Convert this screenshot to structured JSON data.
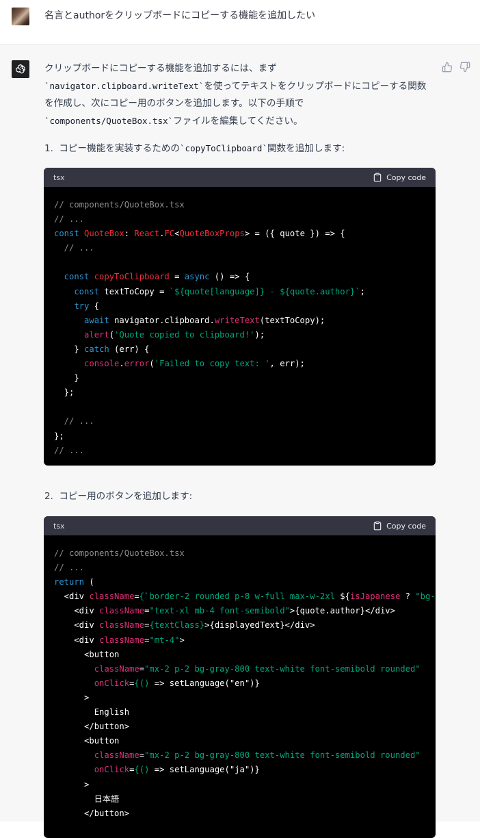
{
  "user": {
    "message": "名言とauthorをクリップボードにコピーする機能を追加したい"
  },
  "assistant": {
    "intro_1": "クリップボードにコピーする機能を追加するには、まず",
    "intro_2_code": "`navigator.clipboard.writeText`",
    "intro_2_text": "を使ってテキストをクリップボードにコピーする関数",
    "intro_3": "を作成し、次にコピー用のボタンを追加します。以下の手順で",
    "intro_4_code": "`components/QuoteBox.tsx`",
    "intro_4_text": "ファイルを編集してください。",
    "step1_number": "1.",
    "step1_text_a": "コピー機能を実装するための",
    "step1_code": "`copyToClipboard`",
    "step1_text_b": "関数を追加します:",
    "step2_number": "2.",
    "step2_text": "コピー用のボタンを追加します:"
  },
  "code_blocks": [
    {
      "language": "tsx",
      "copy_label": "Copy code",
      "lines": [
        [
          [
            "c-cm",
            "// components/QuoteBox.tsx"
          ]
        ],
        [
          [
            "c-cm",
            "// ..."
          ]
        ],
        [
          [
            "c-kw",
            "const "
          ],
          [
            "c-ty",
            "QuoteBox"
          ],
          [
            "c-tx",
            ": "
          ],
          [
            "c-ty",
            "React"
          ],
          [
            "c-tx",
            "."
          ],
          [
            "c-ty",
            "FC"
          ],
          [
            "c-tx",
            "<"
          ],
          [
            "c-ty",
            "QuoteBoxProps"
          ],
          [
            "c-tx",
            "> = ({ quote }) => {"
          ]
        ],
        [
          [
            "c-cm",
            "  // ..."
          ]
        ],
        [
          [
            "c-tx",
            ""
          ]
        ],
        [
          [
            "c-kw",
            "  const "
          ],
          [
            "c-ty",
            "copyToClipboard"
          ],
          [
            "c-tx",
            " = "
          ],
          [
            "c-kw",
            "async"
          ],
          [
            "c-tx",
            " () => {"
          ]
        ],
        [
          [
            "c-kw",
            "    const "
          ],
          [
            "c-tx",
            "textToCopy = "
          ],
          [
            "c-st",
            "`${quote[language]} - ${quote.author}`"
          ],
          [
            "c-tx",
            ";"
          ]
        ],
        [
          [
            "c-kw",
            "    try"
          ],
          [
            "c-tx",
            " {"
          ]
        ],
        [
          [
            "c-kw",
            "      await "
          ],
          [
            "c-tx",
            "navigator.clipboard."
          ],
          [
            "c-fn",
            "writeText"
          ],
          [
            "c-tx",
            "(textToCopy);"
          ]
        ],
        [
          [
            "c-fn",
            "      alert"
          ],
          [
            "c-tx",
            "("
          ],
          [
            "c-st",
            "'Quote copied to clipboard!'"
          ],
          [
            "c-tx",
            ");"
          ]
        ],
        [
          [
            "c-tx",
            "    } "
          ],
          [
            "c-kw",
            "catch"
          ],
          [
            "c-tx",
            " (err) {"
          ]
        ],
        [
          [
            "c-fn",
            "      console"
          ],
          [
            "c-tx",
            "."
          ],
          [
            "c-fn",
            "error"
          ],
          [
            "c-tx",
            "("
          ],
          [
            "c-st",
            "'Failed to copy text: '"
          ],
          [
            "c-tx",
            ", err);"
          ]
        ],
        [
          [
            "c-tx",
            "    }"
          ]
        ],
        [
          [
            "c-tx",
            "  };"
          ]
        ],
        [
          [
            "c-tx",
            ""
          ]
        ],
        [
          [
            "c-cm",
            "  // ..."
          ]
        ],
        [
          [
            "c-tx",
            "};"
          ]
        ],
        [
          [
            "c-cm",
            "// ..."
          ]
        ]
      ]
    },
    {
      "language": "tsx",
      "copy_label": "Copy code",
      "lines": [
        [
          [
            "c-cm",
            "// components/QuoteBox.tsx"
          ]
        ],
        [
          [
            "c-cm",
            "// ..."
          ]
        ],
        [
          [
            "c-kw",
            "return"
          ],
          [
            "c-tx",
            " ("
          ]
        ],
        [
          [
            "c-tx",
            "  <div "
          ],
          [
            "c-fn",
            "className"
          ],
          [
            "c-tx",
            "="
          ],
          [
            "c-st",
            "{`border-2 rounded p-8 w-full max-w-2xl "
          ],
          [
            "c-tx",
            "${"
          ],
          [
            "c-fn",
            "isJapanese"
          ],
          [
            "c-tx",
            " ? "
          ],
          [
            "c-st",
            "\"bg-"
          ]
        ],
        [
          [
            "c-tx",
            "    <div "
          ],
          [
            "c-fn",
            "className"
          ],
          [
            "c-tx",
            "="
          ],
          [
            "c-st",
            "\"text-xl mb-4 font-semibold\""
          ],
          [
            "c-tx",
            ">{quote.author}</div>"
          ]
        ],
        [
          [
            "c-tx",
            "    <div "
          ],
          [
            "c-fn",
            "className"
          ],
          [
            "c-tx",
            "="
          ],
          [
            "c-st",
            "{textClass}"
          ],
          [
            "c-tx",
            ">{displayedText}</div>"
          ]
        ],
        [
          [
            "c-tx",
            "    <div "
          ],
          [
            "c-fn",
            "className"
          ],
          [
            "c-tx",
            "="
          ],
          [
            "c-st",
            "\"mt-4\""
          ],
          [
            "c-tx",
            ">"
          ]
        ],
        [
          [
            "c-tx",
            "      <button"
          ]
        ],
        [
          [
            "c-fn",
            "        className"
          ],
          [
            "c-tx",
            "="
          ],
          [
            "c-st",
            "\"mx-2 p-2 bg-gray-800 text-white font-semibold rounded\""
          ]
        ],
        [
          [
            "c-fn",
            "        onClick"
          ],
          [
            "c-tx",
            "="
          ],
          [
            "c-st",
            "{() "
          ],
          [
            "c-tx",
            "=> setLanguage(\"en\")}"
          ]
        ],
        [
          [
            "c-tx",
            "      >"
          ]
        ],
        [
          [
            "c-tx",
            "        English"
          ]
        ],
        [
          [
            "c-tx",
            "      </button>"
          ]
        ],
        [
          [
            "c-tx",
            "      <button"
          ]
        ],
        [
          [
            "c-fn",
            "        className"
          ],
          [
            "c-tx",
            "="
          ],
          [
            "c-st",
            "\"mx-2 p-2 bg-gray-800 text-white font-semibold rounded\""
          ]
        ],
        [
          [
            "c-fn",
            "        onClick"
          ],
          [
            "c-tx",
            "="
          ],
          [
            "c-st",
            "{() "
          ],
          [
            "c-tx",
            "=> setLanguage(\"ja\")}"
          ]
        ],
        [
          [
            "c-tx",
            "      >"
          ]
        ],
        [
          [
            "c-tx",
            "        日本語"
          ]
        ],
        [
          [
            "c-tx",
            "      </button>"
          ]
        ]
      ]
    }
  ]
}
